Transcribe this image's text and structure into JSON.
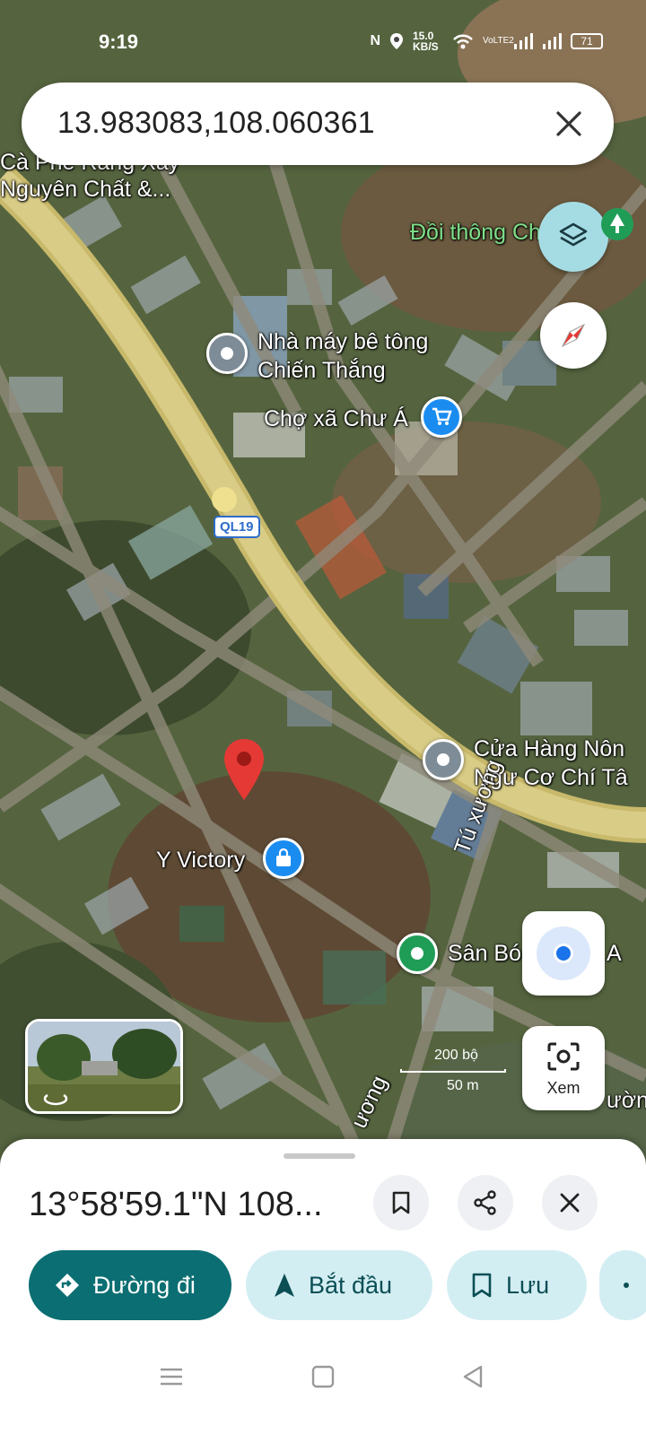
{
  "status_bar": {
    "time": "9:19",
    "net_speed": "15.0 KB/S",
    "volte": "VoLTE2",
    "battery": "71"
  },
  "search": {
    "query": "13.983083,108.060361"
  },
  "map": {
    "labels": {
      "cafe": "Cà Phê Rang Xay",
      "cafe2": "Nguyên Chất &...",
      "hill": "Đồi thông Ch",
      "factory1": "Nhà máy bê tông",
      "factory2": "Chiến Thắng",
      "market": "Chợ xã Chư Á",
      "shop1": "Cửa Hàng Nôn",
      "shop2": "Ngư Cơ Chí Tâ",
      "victory": "Y Victory",
      "street": "Tú xương",
      "stadium": "Sân Bó",
      "stadium_tail": "A",
      "street2": "ương",
      "street2b": "ường",
      "route_shield": "QL19"
    },
    "scale": {
      "feet": "200 bộ",
      "meters": "50 m"
    }
  },
  "fabs": {
    "xem_label": "Xem"
  },
  "sheet": {
    "coords": "13°58'59.1\"N 108...",
    "actions": {
      "directions": "Đường đi",
      "start": "Bắt đầu",
      "save": "Lưu"
    }
  },
  "colors": {
    "primary_chip": "#0b6e72",
    "secondary_chip": "#d3eef3",
    "pin_red": "#e53935",
    "road": "#cdbf6e"
  }
}
